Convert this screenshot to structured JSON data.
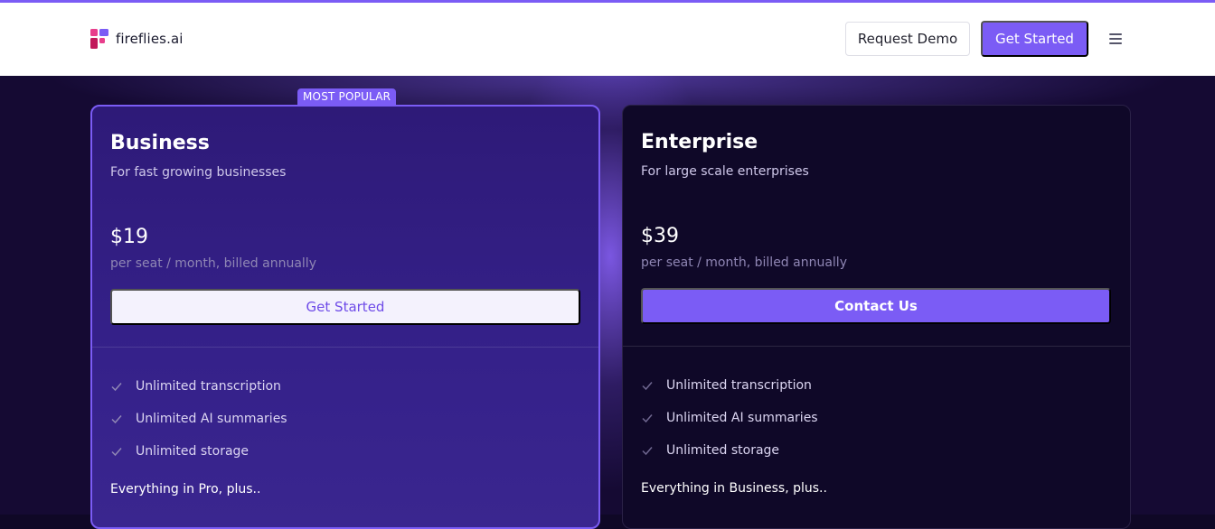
{
  "header": {
    "logo_text": "fireflies.ai",
    "request_demo_label": "Request Demo",
    "get_started_label": "Get Started"
  },
  "colors": {
    "accent": "#7b5cf5",
    "header_bg": "#ffffff",
    "page_bg": "#150a33",
    "business_card_bg": "#2e1a78",
    "enterprise_card_bg": "#0f0828"
  },
  "icons": {
    "logo": "fireflies-logo-icon",
    "menu": "hamburger-menu-icon",
    "check": "check-icon"
  },
  "plans": [
    {
      "badge": "MOST POPULAR",
      "name": "Business",
      "description": "For fast growing businesses",
      "price": "$19",
      "billing": "per seat / month, billed annually",
      "cta_label": "Get Started",
      "features": [
        "Unlimited transcription",
        "Unlimited AI summaries",
        "Unlimited storage"
      ],
      "plus_line": "Everything in Pro, plus.."
    },
    {
      "name": "Enterprise",
      "description": "For large scale enterprises",
      "price": "$39",
      "billing": "per seat / month, billed annually",
      "cta_label": "Contact Us",
      "features": [
        "Unlimited transcription",
        "Unlimited AI summaries",
        "Unlimited storage"
      ],
      "plus_line": "Everything in Business, plus.."
    }
  ]
}
